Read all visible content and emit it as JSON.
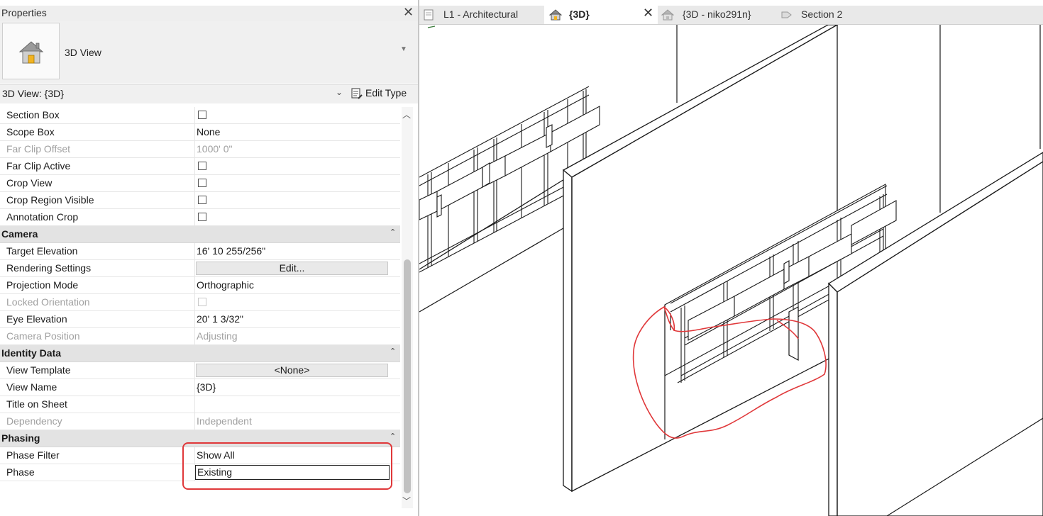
{
  "properties": {
    "title": "Properties",
    "type_name": "3D View",
    "instance_label": "3D View: {3D}",
    "edit_type_label": "Edit Type",
    "rows": [
      {
        "kind": "prop",
        "name": "Section Box",
        "type": "checkbox",
        "checked": false,
        "dim": false
      },
      {
        "kind": "prop",
        "name": "Scope Box",
        "type": "text",
        "value": "None",
        "dim": false
      },
      {
        "kind": "prop",
        "name": "Far Clip Offset",
        "type": "text",
        "value": "1000'  0\"",
        "dim": true
      },
      {
        "kind": "prop",
        "name": "Far Clip Active",
        "type": "checkbox",
        "checked": false,
        "dim": false
      },
      {
        "kind": "prop",
        "name": "Crop View",
        "type": "checkbox",
        "checked": false,
        "dim": false
      },
      {
        "kind": "prop",
        "name": "Crop Region Visible",
        "type": "checkbox",
        "checked": false,
        "dim": false
      },
      {
        "kind": "prop",
        "name": "Annotation Crop",
        "type": "checkbox",
        "checked": false,
        "dim": false
      },
      {
        "kind": "group",
        "name": "Camera"
      },
      {
        "kind": "prop",
        "name": "Target Elevation",
        "type": "text",
        "value": "16'  10 255/256\"",
        "dim": false
      },
      {
        "kind": "prop",
        "name": "Rendering Settings",
        "type": "button",
        "value": "Edit...",
        "dim": false
      },
      {
        "kind": "prop",
        "name": "Projection Mode",
        "type": "text",
        "value": "Orthographic",
        "dim": false
      },
      {
        "kind": "prop",
        "name": "Locked Orientation",
        "type": "checkbox",
        "checked": false,
        "dim": true
      },
      {
        "kind": "prop",
        "name": "Eye Elevation",
        "type": "text",
        "value": "20'  1 3/32\"",
        "dim": false
      },
      {
        "kind": "prop",
        "name": "Camera Position",
        "type": "text",
        "value": "Adjusting",
        "dim": true
      },
      {
        "kind": "group",
        "name": "Identity Data"
      },
      {
        "kind": "prop",
        "name": "View Template",
        "type": "button",
        "value": "<None>",
        "dim": false
      },
      {
        "kind": "prop",
        "name": "View Name",
        "type": "text",
        "value": "{3D}",
        "dim": false
      },
      {
        "kind": "prop",
        "name": "Title on Sheet",
        "type": "text",
        "value": "",
        "dim": false
      },
      {
        "kind": "prop",
        "name": "Dependency",
        "type": "text",
        "value": "Independent",
        "dim": true
      },
      {
        "kind": "group",
        "name": "Phasing"
      },
      {
        "kind": "prop",
        "name": "Phase Filter",
        "type": "text",
        "value": "Show All",
        "dim": false
      },
      {
        "kind": "prop",
        "name": "Phase",
        "type": "input",
        "value": "Existing",
        "dim": false
      }
    ]
  },
  "tabs": [
    {
      "label": "L1 - Architectural",
      "icon": "floor-plan-icon",
      "active": false
    },
    {
      "label": "{3D}",
      "icon": "house-3d-icon",
      "active": true
    },
    {
      "label": "{3D - niko291n}",
      "icon": "house-3d-icon",
      "active": false
    },
    {
      "label": "Section 2",
      "icon": "section-icon",
      "active": false
    }
  ],
  "colors": {
    "annotation_red": "#e0383a",
    "panel_bg": "#f0f0f0",
    "group_bg": "#e3e3e3"
  }
}
